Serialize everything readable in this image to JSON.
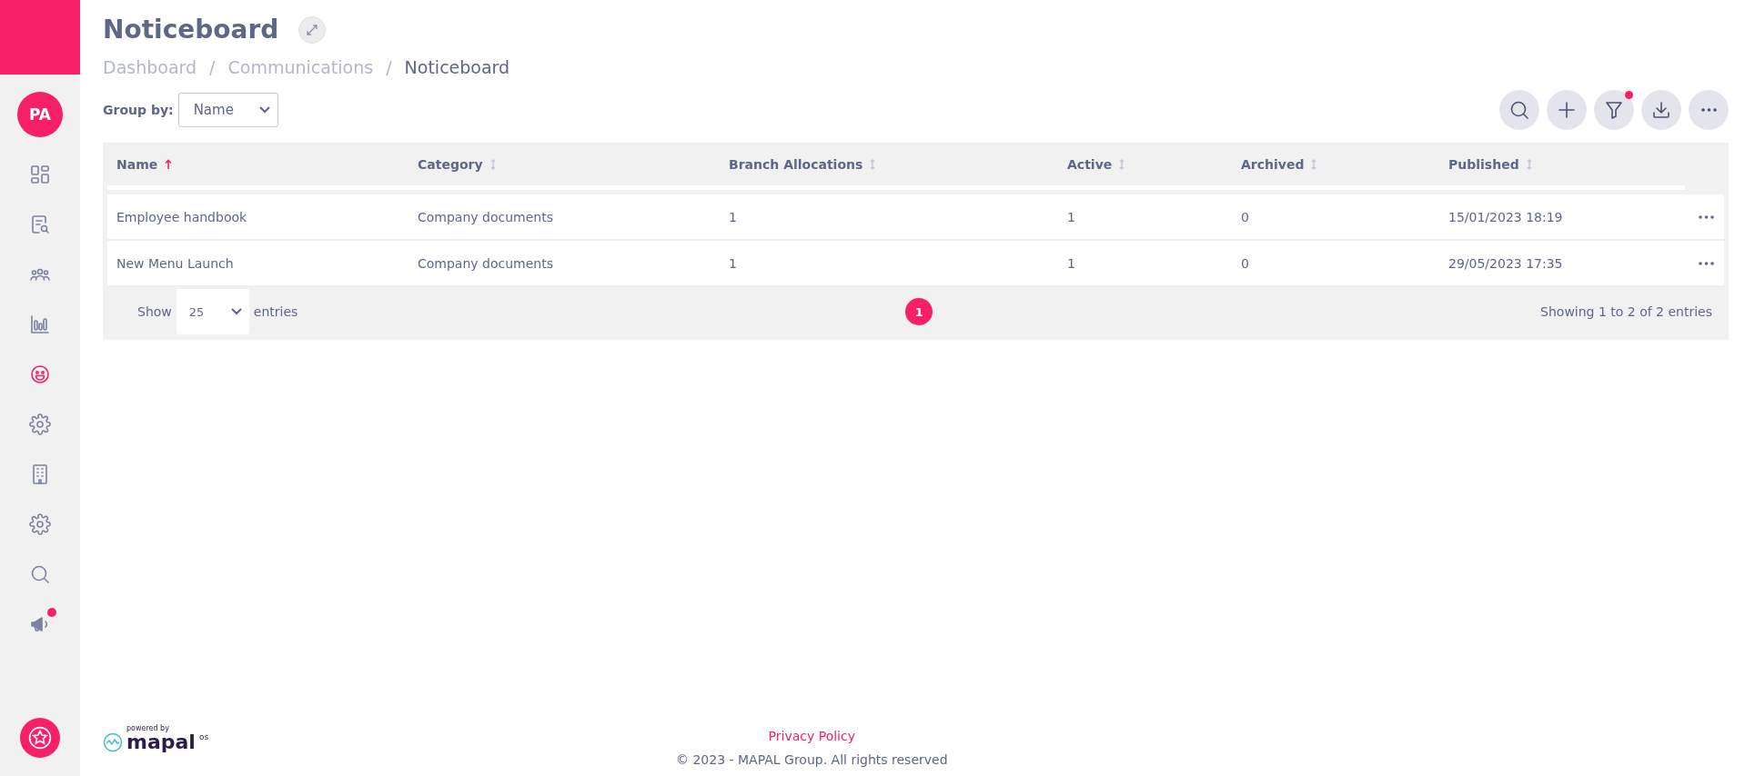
{
  "sidebar": {
    "avatar": "PA",
    "items": [
      {
        "selected": false,
        "notification": false
      },
      {
        "selected": false,
        "notification": false
      },
      {
        "selected": false,
        "notification": false
      },
      {
        "selected": false,
        "notification": false
      },
      {
        "selected": true,
        "notification": false
      },
      {
        "selected": false,
        "notification": false
      },
      {
        "selected": false,
        "notification": false
      },
      {
        "selected": false,
        "notification": false
      },
      {
        "selected": false,
        "notification": false
      },
      {
        "selected": false,
        "notification": true
      }
    ]
  },
  "header": {
    "title": "Noticeboard",
    "breadcrumb": [
      {
        "label": "Dashboard",
        "current": false
      },
      {
        "label": "Communications",
        "current": false
      },
      {
        "label": "Noticeboard",
        "current": true
      }
    ],
    "separator": "/"
  },
  "group_by": {
    "label": "Group by:",
    "value": "Name"
  },
  "toolbar": [
    {
      "notification": false
    },
    {
      "notification": false
    },
    {
      "notification": true
    },
    {
      "notification": false
    },
    {
      "notification": false
    }
  ],
  "table": {
    "columns": [
      {
        "label": "Name",
        "sorted": true
      },
      {
        "label": "Category",
        "sorted": false
      },
      {
        "label": "Branch Allocations",
        "sorted": false
      },
      {
        "label": "Active",
        "sorted": false
      },
      {
        "label": "Archived",
        "sorted": false
      },
      {
        "label": "Published",
        "sorted": false
      }
    ],
    "rows": [
      [
        "Employee handbook",
        "Company documents",
        "1",
        "1",
        "0",
        "15/01/2023 18:19"
      ],
      [
        "New Menu Launch",
        "Company documents",
        "1",
        "1",
        "0",
        "29/05/2023 17:35"
      ]
    ]
  },
  "pagination": {
    "show_label": "Show",
    "page_size": "25",
    "entries_label": "entries",
    "pages": [
      {
        "label": "1",
        "selected": true
      }
    ],
    "info": "Showing 1 to 2 of 2 entries"
  },
  "footer": {
    "powered_by": "powered by",
    "brand": "mapal",
    "brand_suffix": "os",
    "link": "Privacy Policy",
    "copyright": "© 2023 - MAPAL Group. All rights reserved"
  }
}
